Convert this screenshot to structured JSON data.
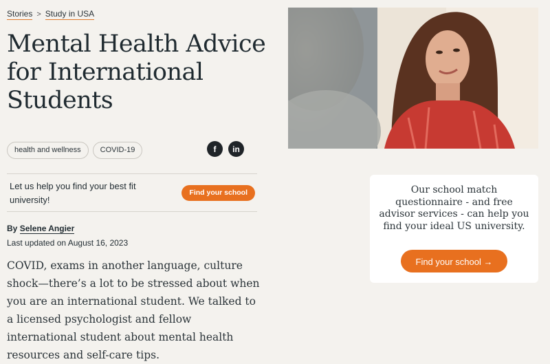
{
  "breadcrumb": {
    "items": [
      "Stories",
      "Study in USA"
    ],
    "separator": ">"
  },
  "article": {
    "title": "Mental Health Advice for International Students",
    "tags": [
      "health and wellness",
      "COVID-19"
    ],
    "author_prefix": "By",
    "author": "Selene Angier",
    "updated": "Last updated on August 16, 2023",
    "intro": "COVID, exams in another language, culture shock—there’s a lot to be stressed about when you are an international student. We talked to a licensed psychologist and fellow international student about mental health resources and self-care tips."
  },
  "social": {
    "facebook_glyph": "f",
    "linkedin_glyph": "in",
    "icons": [
      "facebook-icon",
      "linkedin-icon"
    ]
  },
  "cta": {
    "text": "Let us help you find your best fit university!",
    "button": "Find your school"
  },
  "card": {
    "text": "Our school match questionnaire - and free advisor services - can help you find your ideal US university.",
    "button": "Find your school →"
  },
  "colors": {
    "accent": "#e8701f",
    "background": "#f4f2ee",
    "text": "#1f2a30"
  }
}
